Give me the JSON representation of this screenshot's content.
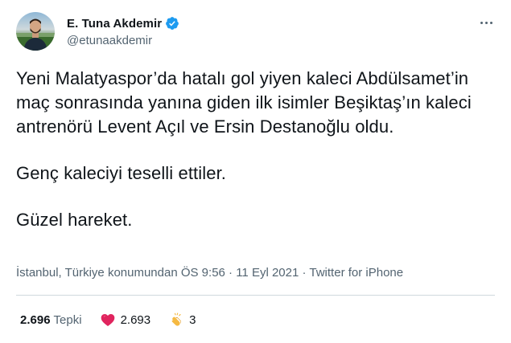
{
  "author": {
    "display_name": "E. Tuna Akdemir",
    "handle": "@etunaakdemir",
    "verified_icon": "verified-badge-icon"
  },
  "tweet": {
    "paragraphs": [
      "Yeni Malatyaspor’da hatalı gol yiyen kaleci Abdülsamet’in maç sonrasında yanına giden ilk isimler Beşiktaş’ın kaleci antrenörü Levent Açıl ve Ersin Destanoğlu oldu.",
      "Genç kaleciyi teselli ettiler.",
      "Güzel hareket."
    ]
  },
  "meta": {
    "location_time": "İstanbul, Türkiye konumundan ÖS 9:56 · 11 Eyl 2021 · ",
    "source": "Twitter for iPhone"
  },
  "reactions": {
    "total_count": "2.696",
    "total_label": "Tepki",
    "heart_icon": "heart-icon",
    "heart_count": "2.693",
    "clap_icon": "clapping-hands-icon",
    "clap_count": "3"
  },
  "colors": {
    "text": "#0f1419",
    "secondary": "#536471",
    "verified": "#1d9bf0",
    "heart": "#e0245e",
    "divider": "#cfd9de"
  }
}
